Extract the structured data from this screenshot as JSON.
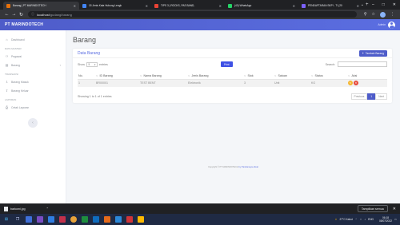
{
  "browser": {
    "tabs": [
      {
        "title": "Barang | PT MARINDOTECH",
        "color": "#e8710a",
        "active": true
      },
      {
        "title": "15 Jenis Kata Hubung Lengk",
        "color": "#4285f4",
        "active": false
      },
      {
        "title": "TIPS 3 | ROCKS, PAS BAND,",
        "color": "#ea4335",
        "active": false
      },
      {
        "title": "(40) WhatsApp",
        "color": "#25d366",
        "active": false
      },
      {
        "title": "PENDAFTARAN SKPI - TI (20",
        "color": "#7b61ff",
        "active": false
      }
    ],
    "new_tab": "+",
    "url_host": "localhost",
    "url_path": "/gudang/barang",
    "window_controls": [
      "⌄",
      "–",
      "□",
      "✕"
    ]
  },
  "app": {
    "brand": "PT MARINDOTECH",
    "user_name": "Admin"
  },
  "sidebar": {
    "items": [
      {
        "label": "Dashboard",
        "icon": "⌂",
        "section": null
      },
      {
        "section": "DATA MASTER"
      },
      {
        "label": "Pegawai",
        "icon": "⚇"
      },
      {
        "label": "Barang",
        "icon": "▤",
        "chevron": "‹"
      },
      {
        "section": "TRANSAKSI"
      },
      {
        "label": "Barang Masuk",
        "icon": "⇩"
      },
      {
        "label": "Barang Keluar",
        "icon": "⇧"
      },
      {
        "section": "LAPORAN"
      },
      {
        "label": "Cetak Laporan",
        "icon": "⎙"
      }
    ],
    "toggle": "‹"
  },
  "page": {
    "title": "Barang",
    "card_title": "Data Barang",
    "add_button": "Tambah Barang",
    "show_label": "Show",
    "show_value": "5",
    "entries_label": "entries",
    "print_button": "Print",
    "search_label": "Search:",
    "columns": [
      "No.",
      "ID Barang",
      "Nama Barang",
      "Jenis Barang",
      "Stok",
      "Satuan",
      "Status",
      "Aksi"
    ],
    "rows": [
      [
        "1",
        "BR00001",
        "TEST BENT",
        "Elektronik",
        "3",
        "Unit",
        "KG"
      ]
    ],
    "info": "Showing 1 to 1 of 1 entries",
    "pager": {
      "prev": "Previous",
      "current": "1",
      "next": "Next"
    },
    "copyright_text": "Copyright © PT MARINDOTECH",
    "copyright_link": "by Pandamaya eltoat"
  },
  "downloads": {
    "file": "barkomi.jpg",
    "show_all": "Tampilkan semua",
    "close": "✕"
  },
  "taskbar": {
    "weather": "27°C Kabut",
    "lang": "ENG",
    "time": "06:18",
    "date": "08/07/2022"
  },
  "colors": {
    "accent": "#4e5cc9",
    "header": "#5b6ee1",
    "edit": "#f5b731",
    "delete": "#e74a3b"
  }
}
